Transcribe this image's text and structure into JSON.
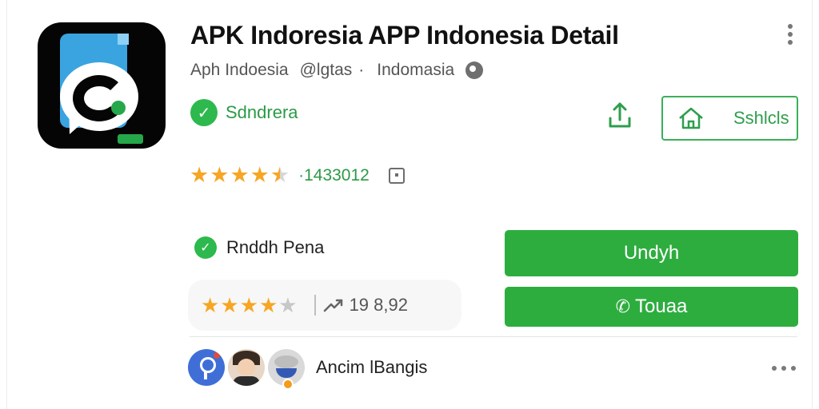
{
  "app": {
    "title": "APK Indoresia APP Indonesia Detail",
    "developer": "Aph Indoesia",
    "handle": "@lgtas",
    "separator": "·",
    "region": "Indomasia",
    "verified_label": "Sdndrera",
    "icon": "chat-bubble-app-icon"
  },
  "actions": {
    "share_icon": "share-icon",
    "wishlist_label": "Sshlcls",
    "wishlist_icon": "home-icon",
    "more_icon": "more-vert-icon"
  },
  "rating": {
    "value": 4.5,
    "max": 5,
    "count_text": "·1433012"
  },
  "feature": {
    "label": "Rnddh Pena"
  },
  "review_summary": {
    "stars": 4,
    "max": 5,
    "count_text": "19 8,92"
  },
  "buttons": {
    "download_label": "Undyh",
    "call_label": "Touaa",
    "call_icon": "phone-icon"
  },
  "people": {
    "name": "Ancim lBangis"
  },
  "colors": {
    "accent_green": "#2ead3f",
    "star_gold": "#f6a623",
    "text_green": "#2b9a46"
  }
}
